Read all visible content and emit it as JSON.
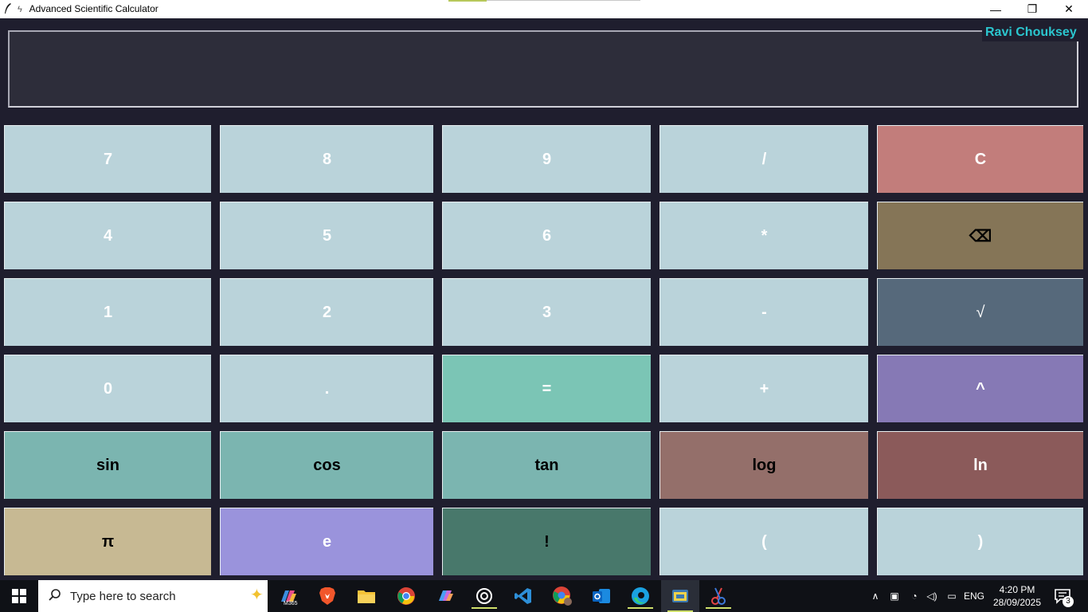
{
  "window": {
    "title": "Advanced Scientific Calculator",
    "minimize_glyph": "—",
    "restore_glyph": "❐",
    "close_glyph": "✕"
  },
  "display": {
    "value": "",
    "author": "Ravi Chouksey"
  },
  "buttons": {
    "row1": [
      "7",
      "8",
      "9",
      "/",
      "C"
    ],
    "row2": [
      "4",
      "5",
      "6",
      "*",
      "⌫"
    ],
    "row3": [
      "1",
      "2",
      "3",
      "-",
      "√"
    ],
    "row4": [
      "0",
      ".",
      "=",
      "+",
      "^"
    ],
    "row5": [
      "sin",
      "cos",
      "tan",
      "log",
      "ln"
    ],
    "row6": [
      "π",
      "e",
      "!",
      "(",
      ")"
    ]
  },
  "colors": {
    "background": "#1f1e2e",
    "display_bg": "#2d2d3a",
    "number_key": "#bad3da",
    "clear": "#c27d7b",
    "backspace": "#857557",
    "sqrt": "#56697b",
    "equals": "#7bc5b5",
    "power": "#8679b5",
    "trig": "#7bb5b0",
    "log": "#946f6a",
    "ln": "#8b5a5a",
    "pi": "#c7b993",
    "e": "#9a93dc",
    "factorial": "#48786b",
    "author_text": "#2bc6cf"
  },
  "taskbar": {
    "search_placeholder": "Type here to search",
    "m365_label": "M365",
    "language": "ENG",
    "time": "4:20 PM",
    "date": "28/09/2025",
    "notification_count": "3",
    "icons": [
      "microsoft365-icon",
      "brave-icon",
      "file-explorer-icon",
      "chrome-icon",
      "copilot-icon",
      "chatgpt-icon",
      "vscode-icon",
      "chrome-profile-icon",
      "outlook-icon",
      "edge-icon",
      "python-icon",
      "snipping-tool-icon"
    ]
  }
}
